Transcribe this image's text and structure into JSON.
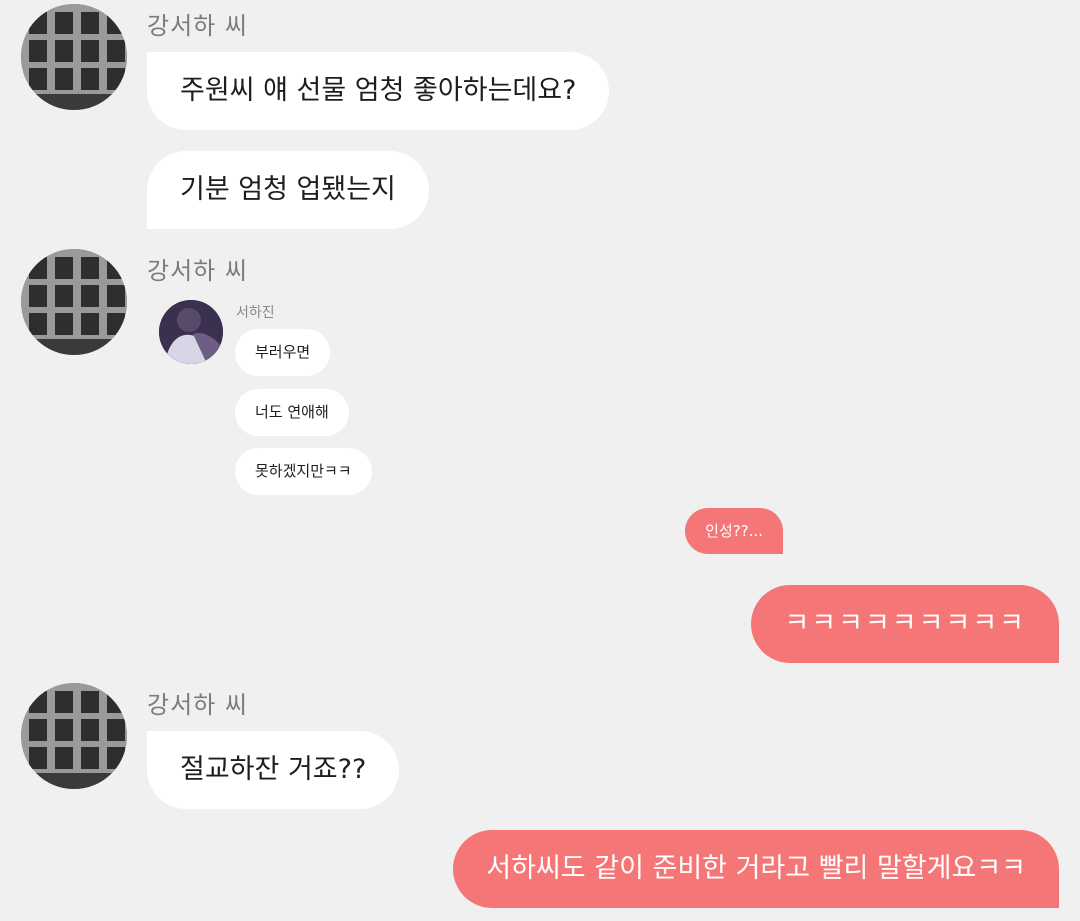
{
  "messages": {
    "group1": {
      "sender": "강서하 씨",
      "bubble1": "주원씨 얘 선물 엄청 좋아하는데요?",
      "bubble2": "기분 엄청 업됐는지"
    },
    "group2": {
      "sender": "강서하 씨",
      "shared_post": {
        "name": "서하진",
        "lines": [
          "부러우면",
          "너도 연애해",
          "못하겠지만ㅋㅋ"
        ]
      }
    },
    "outgoing1": {
      "small": "인성??...",
      "large": "ㅋㅋㅋㅋㅋㅋㅋㅋㅋ"
    },
    "group3": {
      "sender": "강서하 씨",
      "bubble1": "절교하잔 거죠??"
    },
    "outgoing2": {
      "text": "서하씨도 같이 준비한 거라고 빨리 말할게요ㅋㅋ"
    }
  },
  "colors": {
    "background": "#f1f0f0",
    "incoming_bubble": "#ffffff",
    "outgoing_bubble": "#f47676",
    "sender_name": "#7b7b7b"
  }
}
